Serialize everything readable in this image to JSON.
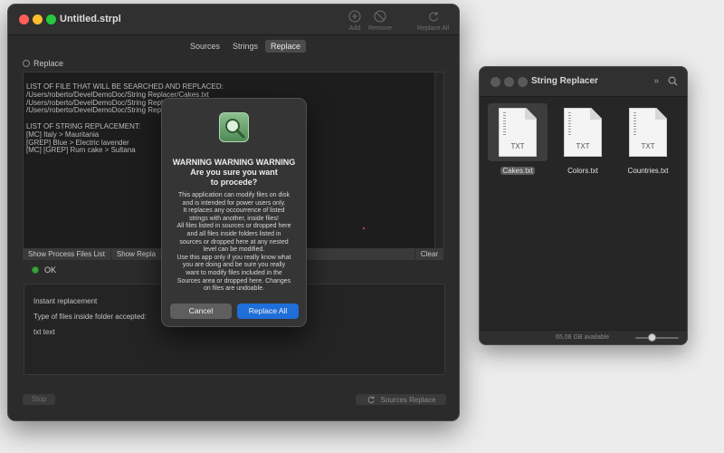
{
  "main_window": {
    "title": "Untitled.strpl",
    "toolbar": {
      "add": "Add",
      "remove": "Remove",
      "replace_all": "Replace All"
    },
    "tabs": [
      "Sources",
      "Strings",
      "Replace"
    ],
    "active_tab": "Replace",
    "section_label": "Replace",
    "log_text": "LIST OF FILE THAT WILL BE SEARCHED AND REPLACED:\n/Users/roberto/DevelDemoDoc/String Replacer/Cakes.txt\n/Users/roberto/DevelDemoDoc/String Replac\n/Users/roberto/DevelDemoDoc/String Replac\n\nLIST OF STRING REPLACEMENT:\n[MC] Italy > Mauritania\n[GREP] Blue > Electric lavender\n[MC] [GREP] Rum cake > Sultana",
    "log_buttons": {
      "show_process": "Show Process Files List",
      "show_replace": "Show Repla",
      "clear": "Clear"
    },
    "status": "OK",
    "status_color": "#3aa53a",
    "options": {
      "instant": "Instant replacement",
      "types_label": "Type of files inside folder accepted:",
      "types_value": "txt text"
    },
    "stop": "Stop",
    "sources_replace": "Sources Replace"
  },
  "alert": {
    "title": "WARNING WARNING WARNING\nAre you sure you want\nto procede?",
    "message": "This application can modify files on disk\nand is intended for power users only.\nIt replaces any occourrence of listed\nstrings with another, inside files!\nAll files listed in sources or dropped here\nand all files inside folders listed in\nsources or dropped here at any nested\nlevel can be modified.\nUse this app only if you really know what\nyou are doing and be sure you really\nwant to modify files included in the\nSources area or dropped here. Changes\non files are undoable.",
    "cancel": "Cancel",
    "confirm": "Replace All",
    "confirm_color": "#1e6fd9"
  },
  "finder": {
    "title": "String Replacer",
    "files": [
      {
        "name": "Cakes.txt",
        "ext": "TXT",
        "selected": true
      },
      {
        "name": "Colors.txt",
        "ext": "TXT",
        "selected": false
      },
      {
        "name": "Countries.txt",
        "ext": "TXT",
        "selected": false
      }
    ],
    "available": "65,08 GB available"
  }
}
